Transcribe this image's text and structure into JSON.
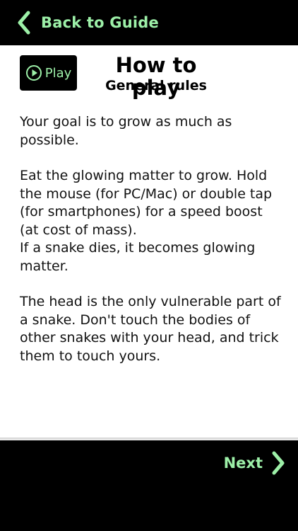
{
  "nav": {
    "back_label": "Back to Guide",
    "back_icon": "chevron-left-icon",
    "next_label": "Next",
    "next_icon": "chevron-right-icon"
  },
  "header": {
    "play_label": "Play",
    "play_icon": "play-circle-icon",
    "title": "How to play",
    "subtitle": "General rules"
  },
  "content": {
    "paragraphs": [
      "Your goal is to grow as much as possible.",
      "Eat the glowing matter to grow. Hold the mouse (for PC/Mac) or double tap (for smartphones) for a speed boost (at cost of mass).",
      "If a snake dies, it becomes glowing matter.",
      "The head is the only vulnerable part of a snake. Don't touch the bodies of other snakes with your head, and trick them to touch yours."
    ]
  },
  "colors": {
    "accent": "#9df0a8",
    "bar_background": "#000000",
    "page_background": "#ffffff"
  }
}
